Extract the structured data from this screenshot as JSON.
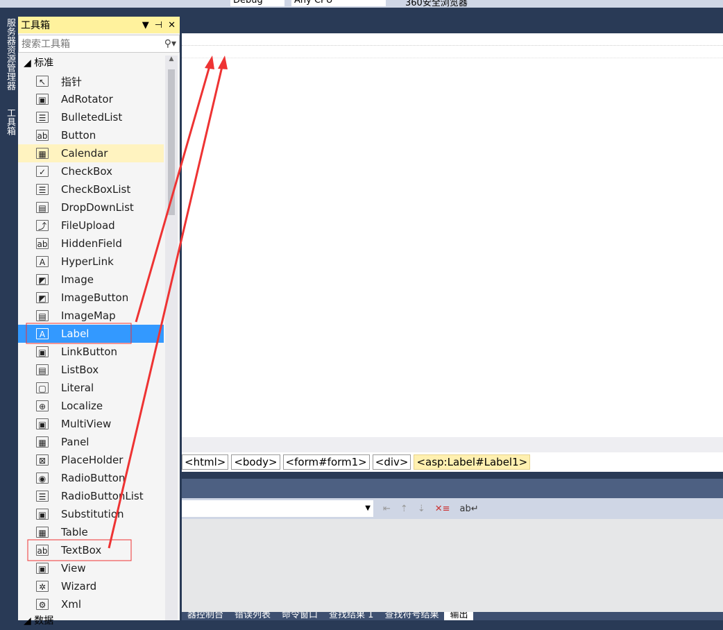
{
  "toolbar": {
    "config": "Debug",
    "platform": "Any CPU",
    "run_target": "360安全浏览器"
  },
  "side_tabs": [
    "服务器资源管理器",
    "工具箱"
  ],
  "toolbox": {
    "title": "工具箱",
    "search_placeholder": "搜索工具箱",
    "group": "标准",
    "next_group": "数据",
    "items": [
      {
        "label": "指针",
        "icon": "pointer-icon",
        "glyph": "↖"
      },
      {
        "label": "AdRotator",
        "icon": "adrotator-icon",
        "glyph": "▣"
      },
      {
        "label": "BulletedList",
        "icon": "bulleted-list-icon",
        "glyph": "☰"
      },
      {
        "label": "Button",
        "icon": "button-icon",
        "glyph": "ab"
      },
      {
        "label": "Calendar",
        "icon": "calendar-icon",
        "glyph": "▦",
        "state": "hover"
      },
      {
        "label": "CheckBox",
        "icon": "checkbox-icon",
        "glyph": "✓"
      },
      {
        "label": "CheckBoxList",
        "icon": "checkbox-list-icon",
        "glyph": "☰"
      },
      {
        "label": "DropDownList",
        "icon": "dropdown-list-icon",
        "glyph": "▤"
      },
      {
        "label": "FileUpload",
        "icon": "file-upload-icon",
        "glyph": "⤴"
      },
      {
        "label": "HiddenField",
        "icon": "hidden-field-icon",
        "glyph": "ab"
      },
      {
        "label": "HyperLink",
        "icon": "hyperlink-icon",
        "glyph": "A"
      },
      {
        "label": "Image",
        "icon": "image-icon",
        "glyph": "◩"
      },
      {
        "label": "ImageButton",
        "icon": "image-button-icon",
        "glyph": "◩"
      },
      {
        "label": "ImageMap",
        "icon": "image-map-icon",
        "glyph": "▤"
      },
      {
        "label": "Label",
        "icon": "label-icon",
        "glyph": "A",
        "state": "selected"
      },
      {
        "label": "LinkButton",
        "icon": "link-button-icon",
        "glyph": "▣"
      },
      {
        "label": "ListBox",
        "icon": "listbox-icon",
        "glyph": "▤"
      },
      {
        "label": "Literal",
        "icon": "literal-icon",
        "glyph": "▢"
      },
      {
        "label": "Localize",
        "icon": "localize-icon",
        "glyph": "⊕"
      },
      {
        "label": "MultiView",
        "icon": "multiview-icon",
        "glyph": "▣"
      },
      {
        "label": "Panel",
        "icon": "panel-icon",
        "glyph": "▦"
      },
      {
        "label": "PlaceHolder",
        "icon": "placeholder-icon",
        "glyph": "⊠"
      },
      {
        "label": "RadioButton",
        "icon": "radio-button-icon",
        "glyph": "◉"
      },
      {
        "label": "RadioButtonList",
        "icon": "radio-button-list-icon",
        "glyph": "☰"
      },
      {
        "label": "Substitution",
        "icon": "substitution-icon",
        "glyph": "▣"
      },
      {
        "label": "Table",
        "icon": "table-icon",
        "glyph": "▦"
      },
      {
        "label": "TextBox",
        "icon": "textbox-icon",
        "glyph": "ab"
      },
      {
        "label": "View",
        "icon": "view-icon",
        "glyph": "▣"
      },
      {
        "label": "Wizard",
        "icon": "wizard-icon",
        "glyph": "✲"
      },
      {
        "label": "Xml",
        "icon": "xml-icon",
        "glyph": "⚙"
      }
    ]
  },
  "breadcrumb": [
    "<html>",
    "<body>",
    "<form#form1>",
    "<div>",
    "<asp:Label#Label1>"
  ],
  "output_tabs": [
    "器控制台",
    "错误列表",
    "命令窗口",
    "查找结果 1",
    "查找符号结果",
    "输出"
  ],
  "annotation_color": "#ee3333"
}
